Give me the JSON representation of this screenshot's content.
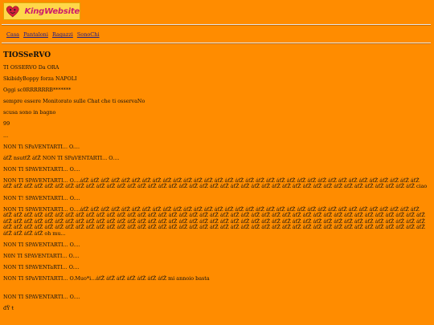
{
  "header": {
    "logo_text": "KingWebsite"
  },
  "nav": {
    "items": [
      {
        "label": "Casa"
      },
      {
        "label": "Pantaloni"
      },
      {
        "label": "Ragazzi"
      },
      {
        "label": "SonoChi"
      }
    ]
  },
  "main": {
    "title": "TIOSSeRVO",
    "lines": [
      "TI OSSERVO Da ORA",
      "SkibidyBoppy forza NAPOLI",
      "Oggi sc0RRRRRRB*******",
      "sempre essere Monitorato sulle Chat che ti osservaNo",
      "scusa sono in bagno",
      "99",
      "...",
      "NON Ti SPaVENTARTI... O....",
      "áťŽ nsutťŽ áťŽ NON TI SPaVENTARTI... O....",
      "NON TI SPAVENTARTI... O....",
      "NON TI SPAVENTARTI... O....áťŽ áťŽ áťŽ áťŽ áťŽ áťŽ áťŽ áťŽ áťŽ áťŽ áťŽ áťŽ áťŽ áťŽ áťŽ áťŽ áťŽ áťŽ áťŽ áťŽ áťŽ áťŽ áťŽ áťŽ áťŽ áťŽ áťŽ áťŽ áťŽ áťŽ áťŽ áťŽ áťŽ áťŽ áťŽ áťŽ áťŽ áťŽ áťŽ áťŽ áťŽ áťŽ áťŽ áťŽ áťŽ áťŽ áťŽ áťŽ áťŽ áťŽ áťŽ áťŽ áťŽ áťŽ áťŽ áťŽ áťŽ áťŽ áťŽ áťŽ áťŽ áťŽ áťŽ áťŽ áťŽ áťŽ áťŽ áťŽ áťŽ áťŽ áťŽ áťŽ áťŽ ciao",
      "NON T! SPAVENTARTI... O....",
      "NON TI SPAVENTARTI... O....áťŽ áťŽ áťŽ áťŽ áťŽ áťŽ áťŽ áťŽ áťŽ áťŽ áťŽ áťŽ áťŽ áťŽ áťŽ áťŽ áťŽ áťŽ áťŽ áťŽ áťŽ áťŽ áťŽ áťŽ áťŽ áťŽ áťŽ áťŽ áťŽ áťŽ áťŽ áťŽ áťŽ áťŽ áťŽ áťŽ áťŽ áťŽ áťŽ áťŽ áťŽ áťŽ áťŽ áťŽ áťŽ áťŽ áťŽ áťŽ áťŽ áťŽ áťŽ áťŽ áťŽ áťŽ áťŽ áťŽ áťŽ áťŽ áťŽ áťŽ áťŽ áťŽ áťŽ áťŽ áťŽ áťŽ áťŽ áťŽ áťŽ áťŽ áťŽ áťŽ áťŽ áťŽ áťŽ áťŽ áťŽ áťŽ áťŽ áťŽ áťŽ áťŽ áťŽ áťŽ áťŽ áťŽ áťŽ áťŽ áťŽ áťŽ áťŽ áťŽ áťŽ áťŽ áťŽ áťŽ áťŽ áťŽ áťŽ áťŽ áťŽ áťŽ áťŽ áťŽ áťŽ áťŽ áťŽ áťŽ áťŽ áťŽ áťŽ áťŽ áťŽ áťŽ áťŽ áťŽ áťŽ áťŽ áťŽ áťŽ áťŽ áťŽ áťŽ áťŽ áťŽ áťŽ áťŽ áťŽ áťŽ áťŽ áťŽ áťŽ áťŽ áťŽ áťŽ áťŽ áťŽ áťŽ áťŽ áťŽ áťŽ áťŽ áťŽ áťŽ áťŽ áťŽ áťŽ áťŽ áťŽ áťŽ áťŽ áťŽ áťŽ áťŽ áťŽ áťŽ áťŽ áťŽ áťŽ áťŽ oh mu...",
      "NON TI SPAVENTARTI... O....",
      "N0N TI SPAVENTARTI... O....",
      "NON TI SPAVENTaRTI... O....",
      "NON TI SPaVENTARTI... O.Muo*i...áťŽ áťŽ áťŽ áťŽ áťŽ áťŽ áťŽ mi annoio basta",
      "",
      "NON TI SPAVENTARTI... O....",
      "đŸ   ŧ"
    ]
  }
}
